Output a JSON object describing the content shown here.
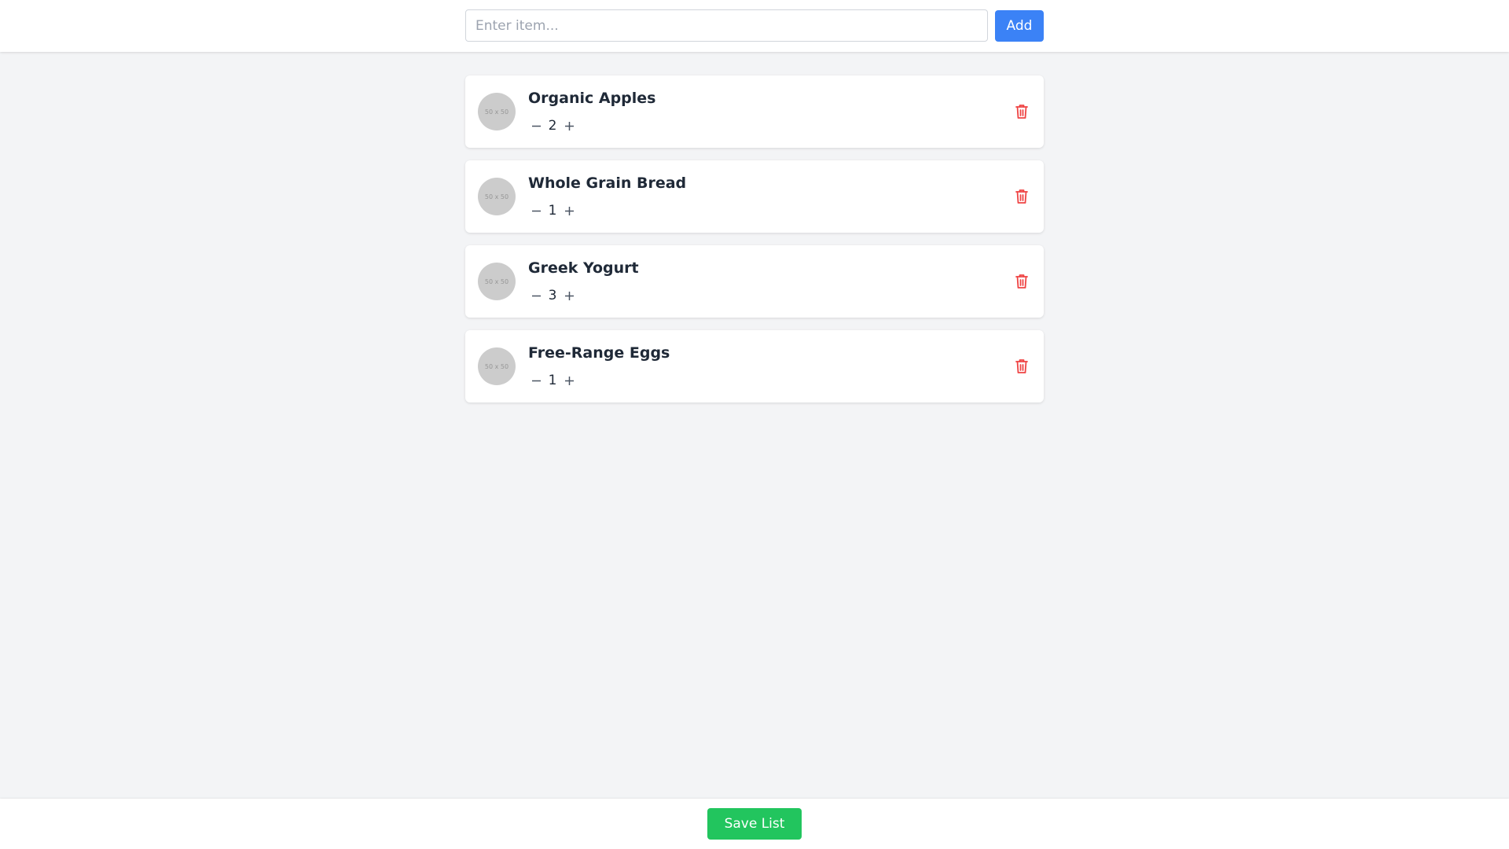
{
  "header": {
    "input_value": "",
    "input_placeholder": "Enter item...",
    "add_label": "Add"
  },
  "items": [
    {
      "name": "Organic Apples",
      "quantity": "2",
      "image_placeholder": "50 x 50",
      "minus": "−",
      "plus": "+"
    },
    {
      "name": "Whole Grain Bread",
      "quantity": "1",
      "image_placeholder": "50 x 50",
      "minus": "−",
      "plus": "+"
    },
    {
      "name": "Greek Yogurt",
      "quantity": "3",
      "image_placeholder": "50 x 50",
      "minus": "−",
      "plus": "+"
    },
    {
      "name": "Free-Range Eggs",
      "quantity": "1",
      "image_placeholder": "50 x 50",
      "minus": "−",
      "plus": "+"
    }
  ],
  "footer": {
    "save_label": "Save List"
  },
  "icons": {
    "delete": "trash-icon",
    "decrement": "minus-icon",
    "increment": "plus-icon"
  },
  "colors": {
    "background": "#f3f4f6",
    "add_button": "#3b82f6",
    "save_button": "#22c55e",
    "delete_icon": "#ef4444",
    "placeholder_image": "#cccccc"
  }
}
